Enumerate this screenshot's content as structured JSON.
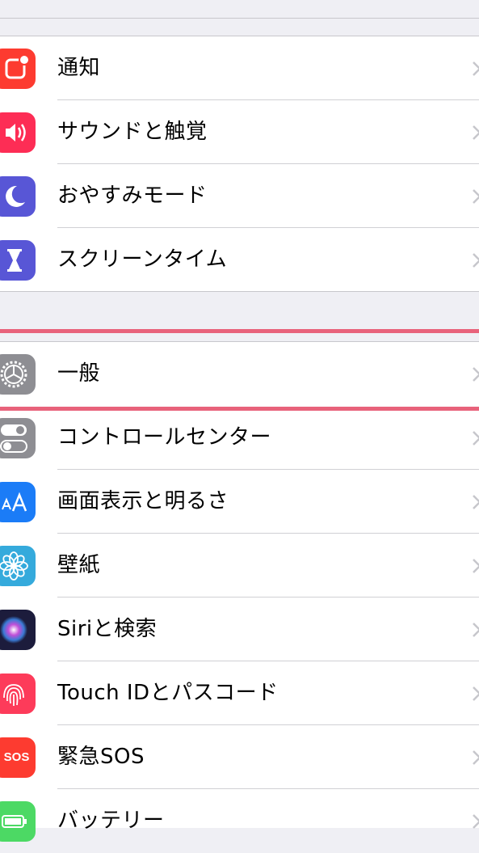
{
  "settings": {
    "group1": [
      {
        "label": "通知",
        "icon": "notifications-icon",
        "color": "#fd3b30"
      },
      {
        "label": "サウンドと触覚",
        "icon": "speaker-icon",
        "color": "#fd2d55"
      },
      {
        "label": "おやすみモード",
        "icon": "moon-icon",
        "color": "#5856d6"
      },
      {
        "label": "スクリーンタイム",
        "icon": "hourglass-icon",
        "color": "#5856d6"
      }
    ],
    "group2": [
      {
        "label": "一般",
        "icon": "gear-icon",
        "color": "#8e8e93",
        "highlighted": true
      },
      {
        "label": "コントロールセンター",
        "icon": "toggles-icon",
        "color": "#8e8e93"
      },
      {
        "label": "画面表示と明るさ",
        "icon": "text-size-icon",
        "color": "#1b7cf7"
      },
      {
        "label": "壁紙",
        "icon": "flower-icon",
        "color": "#35aadc"
      },
      {
        "label": "Siriと検索",
        "icon": "siri-icon",
        "color": "#1c1c3c"
      },
      {
        "label": "Touch IDとパスコード",
        "icon": "fingerprint-icon",
        "color": "#fd3b5a"
      },
      {
        "label": "緊急SOS",
        "icon": "sos-icon",
        "color": "#fd3b30",
        "icon_text": "SOS"
      },
      {
        "label": "バッテリー",
        "icon": "battery-icon",
        "color": "#4cd964"
      }
    ]
  },
  "highlight_color": "#e8627b"
}
